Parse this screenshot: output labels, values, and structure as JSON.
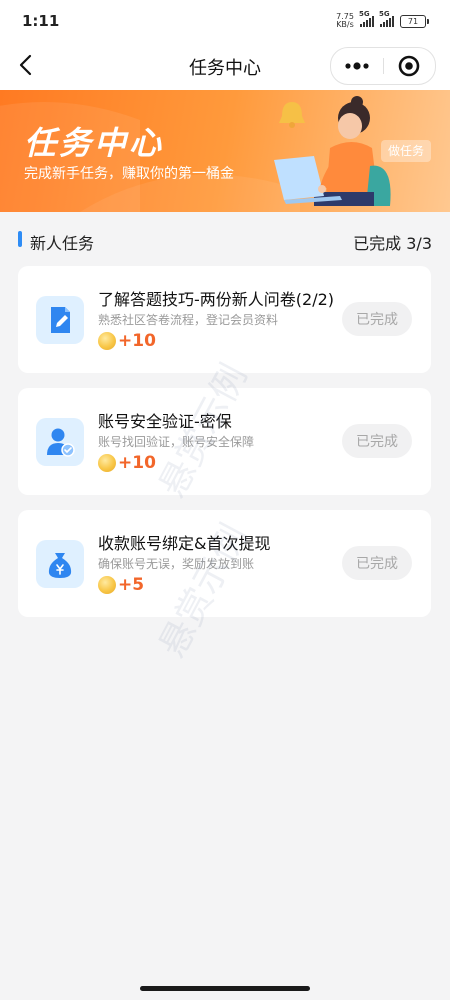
{
  "status_bar": {
    "time": "1:11",
    "net_speed_value": "7.75",
    "net_speed_unit": "KB/s",
    "sim_tag": "5G",
    "battery": "71"
  },
  "nav": {
    "title": "任务中心"
  },
  "banner": {
    "title": "任务中心",
    "subtitle": "完成新手任务，赚取你的第一桶金",
    "badge": "做任务"
  },
  "section": {
    "title": "新人任务",
    "progress": "已完成 3/3"
  },
  "tasks": [
    {
      "icon": "edit-document-icon",
      "title": "了解答题技巧-两份新人问卷(2/2)",
      "desc": "熟悉社区答卷流程，登记会员资料",
      "reward": "+10",
      "status": "已完成"
    },
    {
      "icon": "user-verified-icon",
      "title": "账号安全验证-密保",
      "desc": "账号找回验证，账号安全保障",
      "reward": "+10",
      "status": "已完成"
    },
    {
      "icon": "money-bag-icon",
      "title": "收款账号绑定&首次提现",
      "desc": "确保账号无误，奖励发放到账",
      "reward": "+5",
      "status": "已完成"
    }
  ],
  "watermark": "悬赏示例",
  "colors": {
    "accent_orange": "#ff7a22",
    "reward_red": "#f2662a",
    "section_bar_blue": "#2e8cf5",
    "icon_blue": "#2f86f0"
  }
}
